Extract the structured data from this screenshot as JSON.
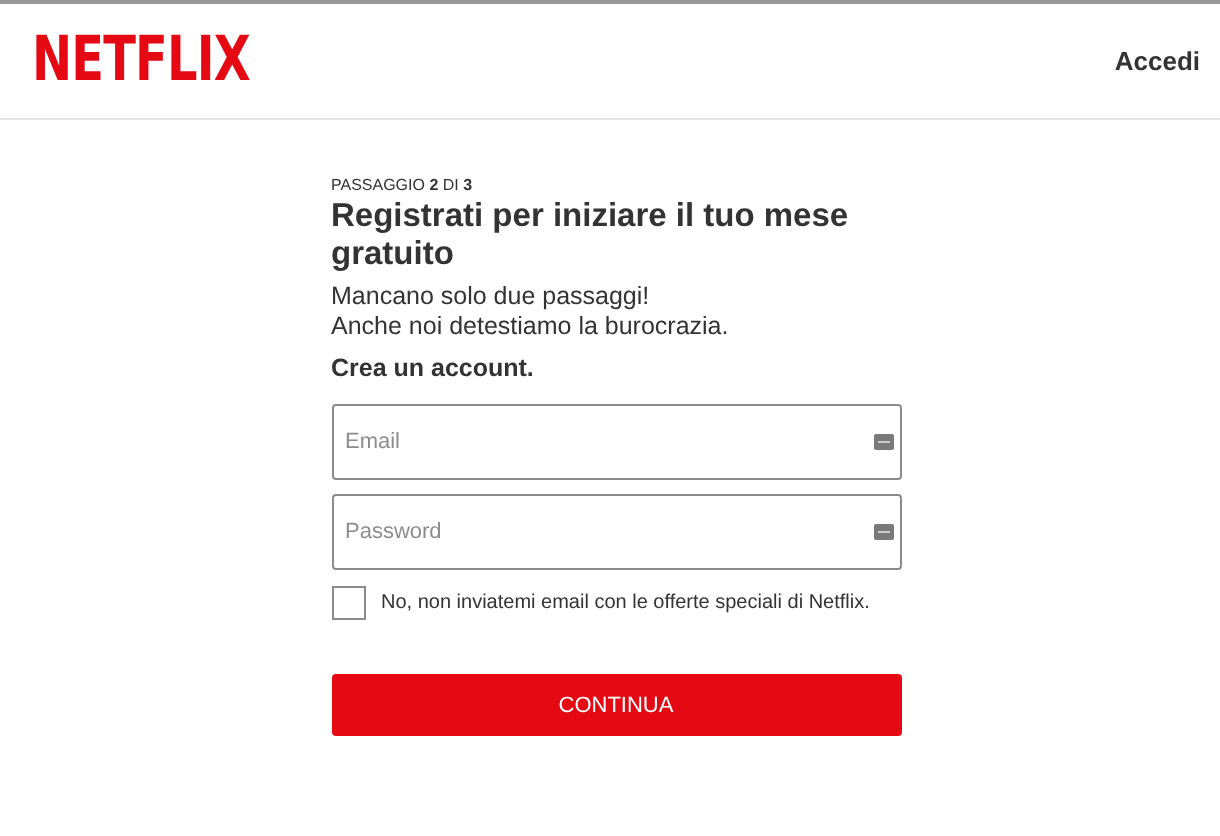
{
  "header": {
    "logo": "NETFLIX",
    "sign_in": "Accedi"
  },
  "form": {
    "step": "PASSAGGIO **2** DI **3**",
    "title": "Registrati per iniziare il tuo mese gratuito",
    "subtitle_lines": [
      "Mancano solo due passaggi!",
      "Anche noi detestiamo la burocrazia."
    ],
    "section": "Crea un account.",
    "fields": [
      {
        "placeholder": "Email"
      },
      {
        "placeholder": "Password"
      }
    ],
    "opt_out": {
      "label": "No, non inviatemi email con le offerte speciali di Netflix.",
      "checked": false
    },
    "button": "CONTINUA"
  }
}
